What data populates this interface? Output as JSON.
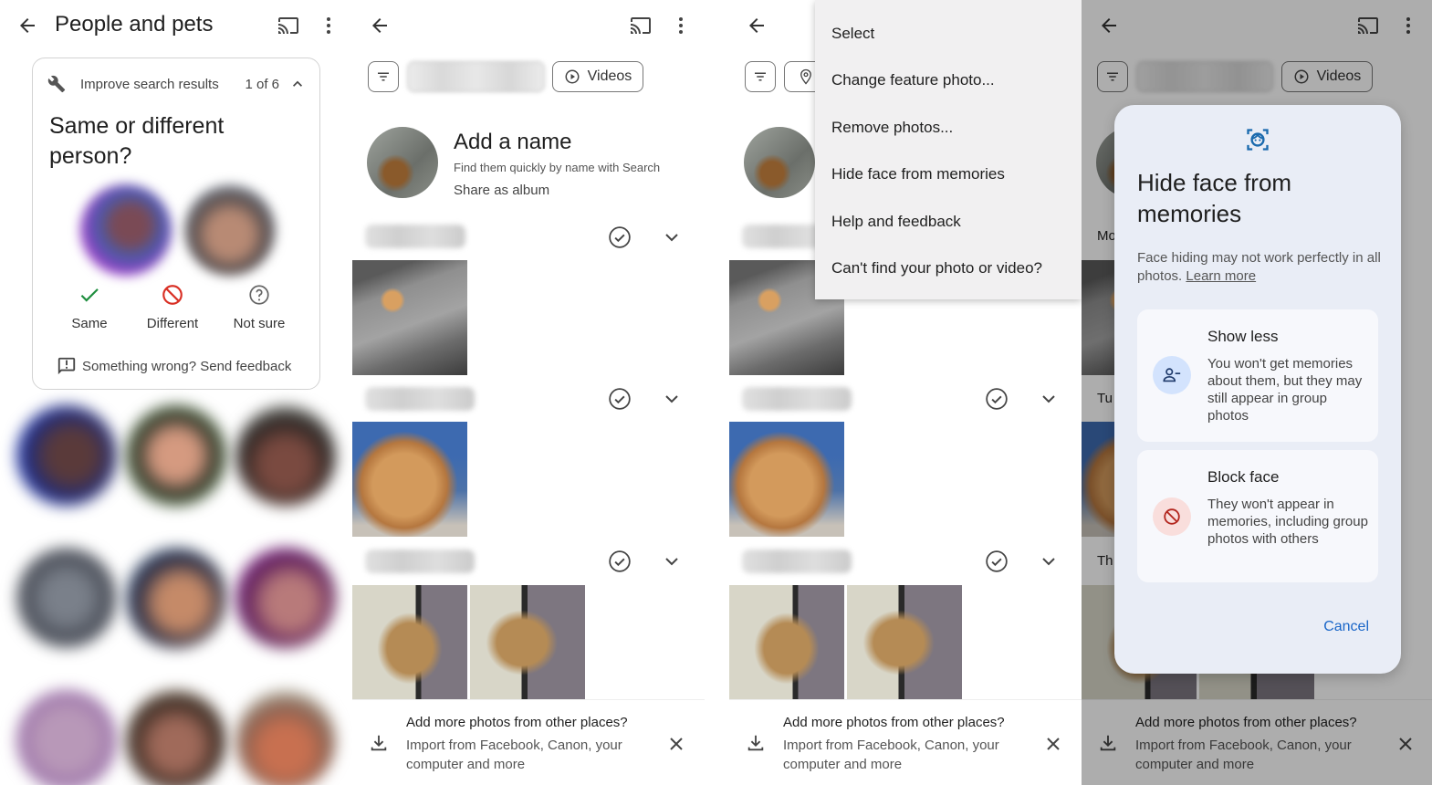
{
  "panel1": {
    "title": "People and pets",
    "card": {
      "header": "Improve search results",
      "counter": "1 of 6",
      "question": "Same or different person?",
      "choices": [
        {
          "label": "Same",
          "icon": "check-icon",
          "color": "#1e8e3e"
        },
        {
          "label": "Different",
          "icon": "block-icon",
          "color": "#d93025"
        },
        {
          "label": "Not sure",
          "icon": "help-icon",
          "color": "#666666"
        }
      ],
      "feedback": "Something wrong? Send feedback"
    }
  },
  "person_view": {
    "chips": {
      "videos": "Videos"
    },
    "name_title": "Add a name",
    "name_subtitle": "Find them quickly by name with Search",
    "share": "Share as album",
    "banner": {
      "title": "Add more photos from other places?",
      "subtitle": "Import from Facebook, Canon, your computer and more"
    }
  },
  "menu": {
    "items": [
      "Select",
      "Change feature photo...",
      "Remove photos...",
      "Hide face from memories",
      "Help and feedback",
      "Can't find your photo or video?"
    ]
  },
  "dialog": {
    "title": "Hide face from memories",
    "description": "Face hiding may not work perfectly in all photos.",
    "learn_more": "Learn more",
    "options": [
      {
        "title": "Show less",
        "description": "You won't get memories about them, but they may still appear in group photos",
        "icon": "person-remove-icon",
        "icon_bg": "#d3e3fd",
        "icon_color": "#1f3a6b"
      },
      {
        "title": "Block face",
        "description": "They won't appear in memories, including group photos with others",
        "icon": "block-icon",
        "icon_bg": "#f9dedc",
        "icon_color": "#b3261e"
      }
    ],
    "cancel": "Cancel",
    "peek_dates": [
      "Mo",
      "Tu",
      "Th"
    ]
  },
  "colors": {
    "accent": "#1a66c8"
  }
}
